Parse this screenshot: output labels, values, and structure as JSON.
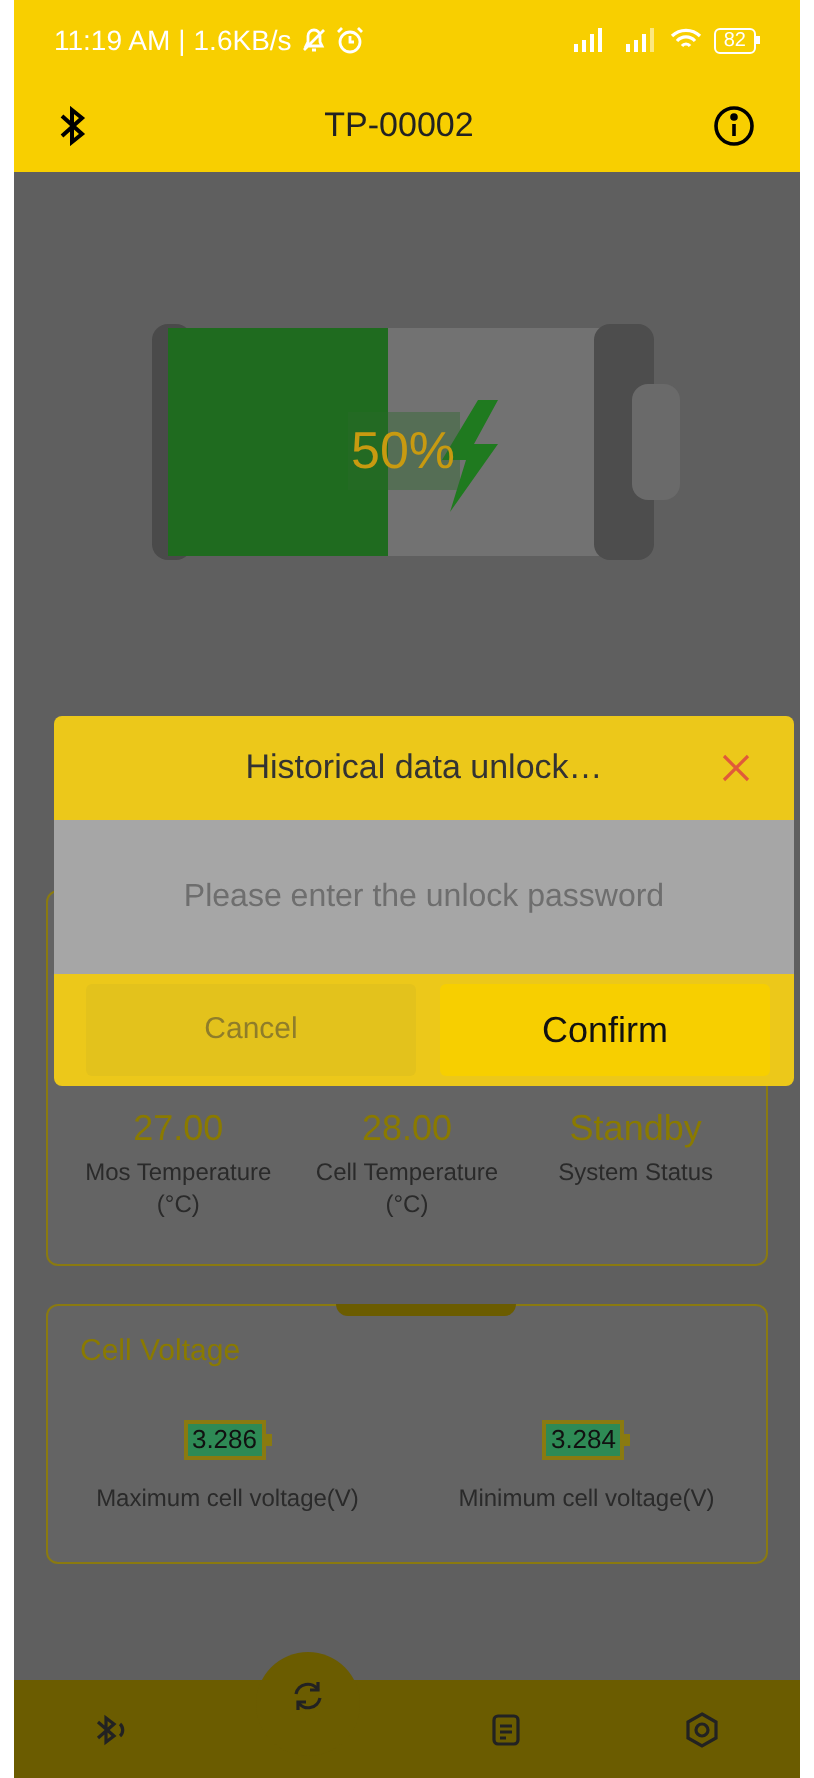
{
  "status_bar": {
    "time": "11:19 AM",
    "separator": "|",
    "speed": "1.6KB/s",
    "battery": "82"
  },
  "app_bar": {
    "title": "TP-00002"
  },
  "battery": {
    "level": 0.5,
    "label": "50%"
  },
  "status_card": {
    "items": [
      {
        "value": "27.00",
        "label": "Mos Temperature (°C)"
      },
      {
        "value": "28.00",
        "label": "Cell Temperature (°C)"
      },
      {
        "value": "Standby",
        "label": "System Status"
      }
    ]
  },
  "cell_voltage": {
    "title": "Cell Voltage",
    "items": [
      {
        "value": "3.286",
        "label": "Maximum cell voltage(V)"
      },
      {
        "value": "3.284",
        "label": "Minimum cell voltage(V)"
      }
    ]
  },
  "nav": [
    {
      "kind": "bluetooth",
      "selected": false
    },
    {
      "kind": "refresh",
      "selected": true
    },
    {
      "kind": "document",
      "selected": false
    },
    {
      "kind": "settings",
      "selected": false
    }
  ],
  "dialog": {
    "title": "Historical data unlock…",
    "placeholder": "Please enter the unlock password",
    "buttons": [
      {
        "label": "Cancel",
        "kind": "cancel"
      },
      {
        "label": "Confirm",
        "kind": "confirm"
      }
    ]
  }
}
